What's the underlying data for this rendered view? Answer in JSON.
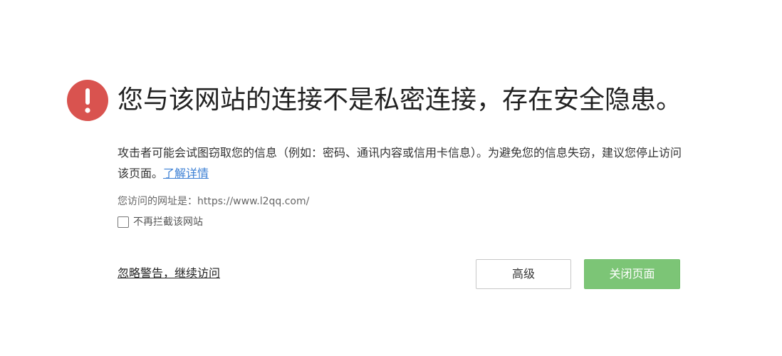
{
  "warning": {
    "icon": "exclamation-circle-icon",
    "icon_color": "#d9534f",
    "title": "您与该网站的连接不是私密连接，存在安全隐患。",
    "description": "攻击者可能会试图窃取您的信息（例如：密码、通讯内容或信用卡信息）。为避免您的信息失窃，建议您停止访问该页面。",
    "learn_more": "了解详情",
    "url_label": "您访问的网址是：https://www.l2qq.com/",
    "dont_block_label": "不再拦截该网站"
  },
  "actions": {
    "ignore_link": "忽略警告，继续访问",
    "advanced_button": "高级",
    "close_button": "关闭页面",
    "close_button_color": "#7cc576"
  }
}
